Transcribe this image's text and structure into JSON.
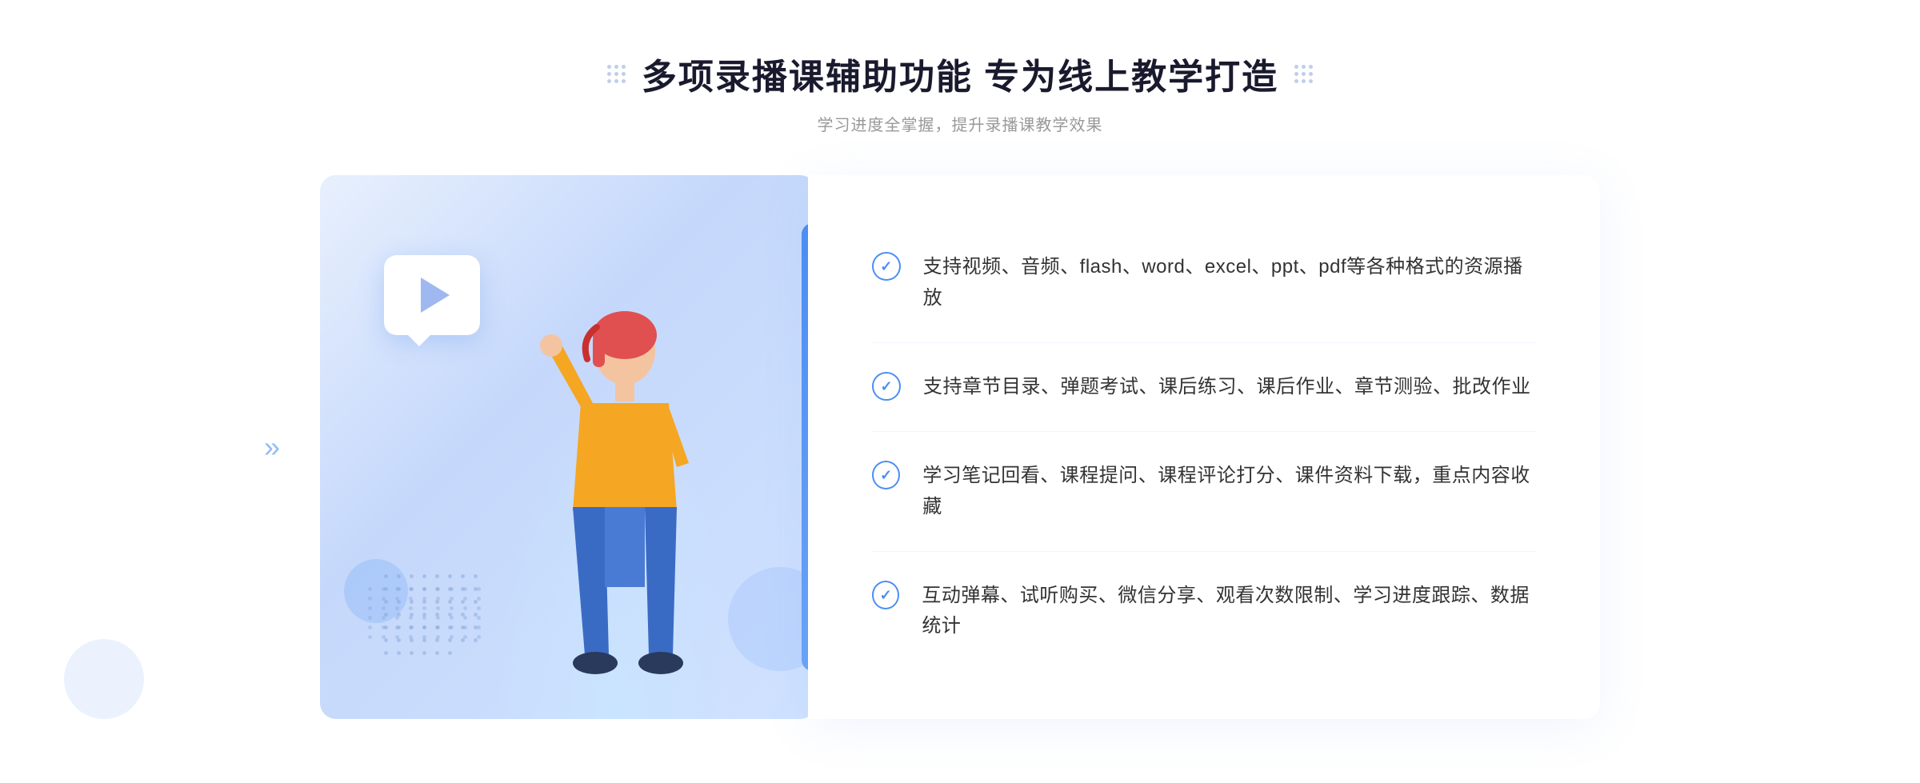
{
  "page": {
    "background": "#ffffff"
  },
  "header": {
    "main_title": "多项录播课辅助功能 专为线上教学打造",
    "subtitle": "学习进度全掌握，提升录播课教学效果"
  },
  "features": [
    {
      "id": "feature-1",
      "text": "支持视频、音频、flash、word、excel、ppt、pdf等各种格式的资源播放"
    },
    {
      "id": "feature-2",
      "text": "支持章节目录、弹题考试、课后练习、课后作业、章节测验、批改作业"
    },
    {
      "id": "feature-3",
      "text": "学习笔记回看、课程提问、课程评论打分、课件资料下载，重点内容收藏"
    },
    {
      "id": "feature-4",
      "text": "互动弹幕、试听购买、微信分享、观看次数限制、学习进度跟踪、数据统计"
    }
  ],
  "decorations": {
    "check_symbol": "✓",
    "arrows": "»"
  }
}
